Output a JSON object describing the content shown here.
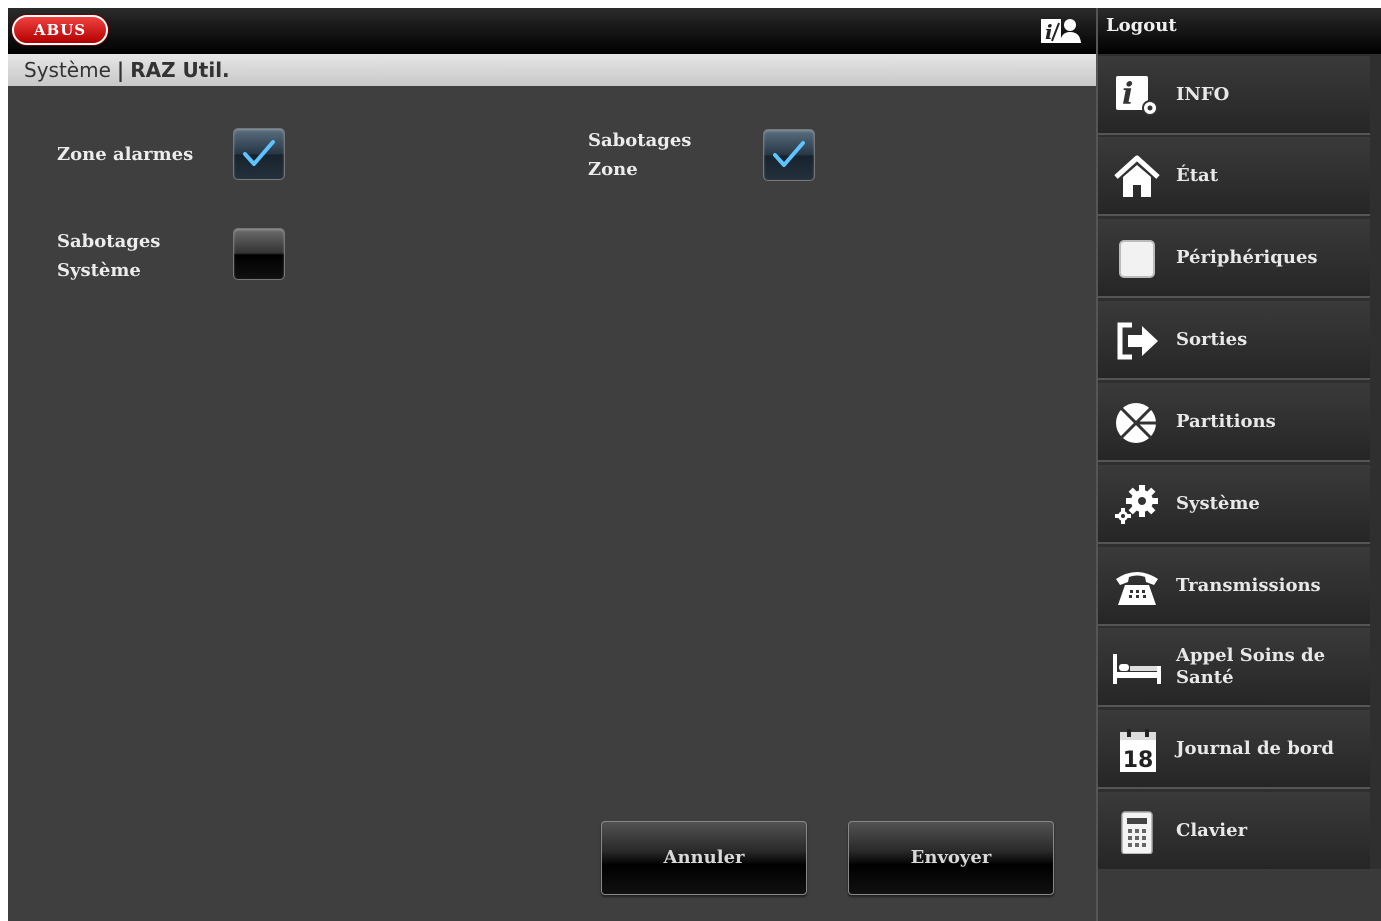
{
  "header": {
    "logo_text": "ABUS",
    "breadcrumb_section": "Système",
    "breadcrumb_separator": "|",
    "page_title": "RAZ Util."
  },
  "sidebar": {
    "logout_label": "Logout",
    "items": [
      {
        "label": "INFO",
        "icon": "info-settings-icon"
      },
      {
        "label": "État",
        "icon": "home-icon"
      },
      {
        "label": "Périphériques",
        "icon": "device-icon"
      },
      {
        "label": "Sorties",
        "icon": "output-arrow-icon"
      },
      {
        "label": "Partitions",
        "icon": "partitions-icon"
      },
      {
        "label": "Système",
        "icon": "gears-icon"
      },
      {
        "label": "Transmissions",
        "icon": "telephone-icon"
      },
      {
        "label": "Appel Soins de Santé",
        "icon": "bed-icon"
      },
      {
        "label": "Journal de bord",
        "icon": "calendar-icon"
      },
      {
        "label": "Clavier",
        "icon": "keypad-icon"
      }
    ]
  },
  "options": [
    {
      "label": "Zone alarmes",
      "checked": true
    },
    {
      "label": "Sabotages Zone",
      "checked": true
    },
    {
      "label": "Sabotages Système",
      "checked": false
    }
  ],
  "calendar_day": "18",
  "buttons": {
    "cancel": "Annuler",
    "send": "Envoyer"
  },
  "colors": {
    "logo_red": "#d01010",
    "background": "#3f3f3f",
    "sidebar": "#2f2f2f",
    "check_blue": "#5fc3ff"
  }
}
